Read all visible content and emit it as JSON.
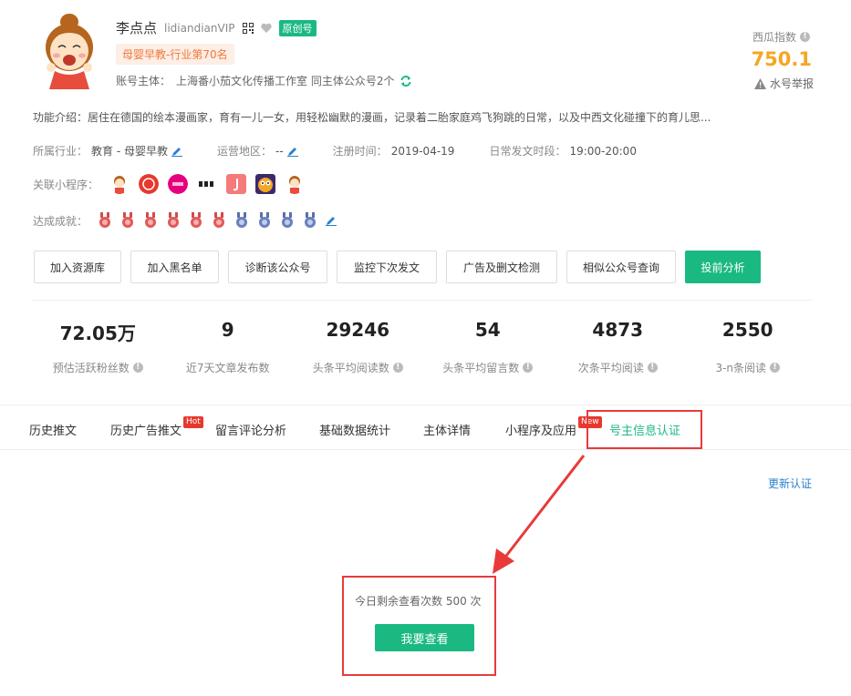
{
  "profile": {
    "name": "李点点",
    "wechat_id": "lidiandianVIP",
    "original_badge": "原创号",
    "rank_tag": "母婴早教-行业第70名",
    "entity_label": "账号主体：",
    "entity_value": "上海番小茄文化传播工作室 同主体公众号2个"
  },
  "index": {
    "label": "西瓜指数",
    "value": "750.1",
    "report_label": "水号举报"
  },
  "description": "功能介绍：居住在德国的绘本漫画家，育有一儿一女，用轻松幽默的漫画，记录着二胎家庭鸡飞狗跳的日常，以及中西文化碰撞下的育儿思...",
  "meta": {
    "industry_label": "所属行业：",
    "industry_value": "教育 - 母婴早教",
    "region_label": "运营地区：",
    "region_value": "--",
    "register_label": "注册时间：",
    "register_value": "2019-04-19",
    "post_time_label": "日常发文时段：",
    "post_time_value": "19:00-20:00"
  },
  "mini_programs_label": "关联小程序：",
  "achievements_label": "达成成就：",
  "actions": {
    "add_resource": "加入资源库",
    "add_blacklist": "加入黑名单",
    "diagnose": "诊断该公众号",
    "monitor_next": "监控下次发文",
    "ad_check": "广告及删文检测",
    "similar": "相似公众号查询",
    "pre_analysis": "投前分析"
  },
  "stats": [
    {
      "value": "72.05万",
      "label": "预估活跃粉丝数"
    },
    {
      "value": "9",
      "label": "近7天文章发布数"
    },
    {
      "value": "29246",
      "label": "头条平均阅读数"
    },
    {
      "value": "54",
      "label": "头条平均留言数"
    },
    {
      "value": "4873",
      "label": "次条平均阅读"
    },
    {
      "value": "2550",
      "label": "3-n条阅读"
    }
  ],
  "tabs": [
    {
      "label": "历史推文"
    },
    {
      "label": "历史广告推文"
    },
    {
      "label": "留言评论分析"
    },
    {
      "label": "基础数据统计"
    },
    {
      "label": "主体详情"
    },
    {
      "label": "小程序及应用"
    },
    {
      "label": "号主信息认证"
    }
  ],
  "badges": {
    "hot": "Hot",
    "new": "New"
  },
  "cert": {
    "update_label": "更新认证",
    "remain_text": "今日剩余查看次数 500 次",
    "view_button": "我要查看"
  },
  "colors": {
    "accent": "#1bb982",
    "index_value": "#f5a623",
    "highlight": "#e83a3a",
    "link": "#2a7fcf"
  }
}
